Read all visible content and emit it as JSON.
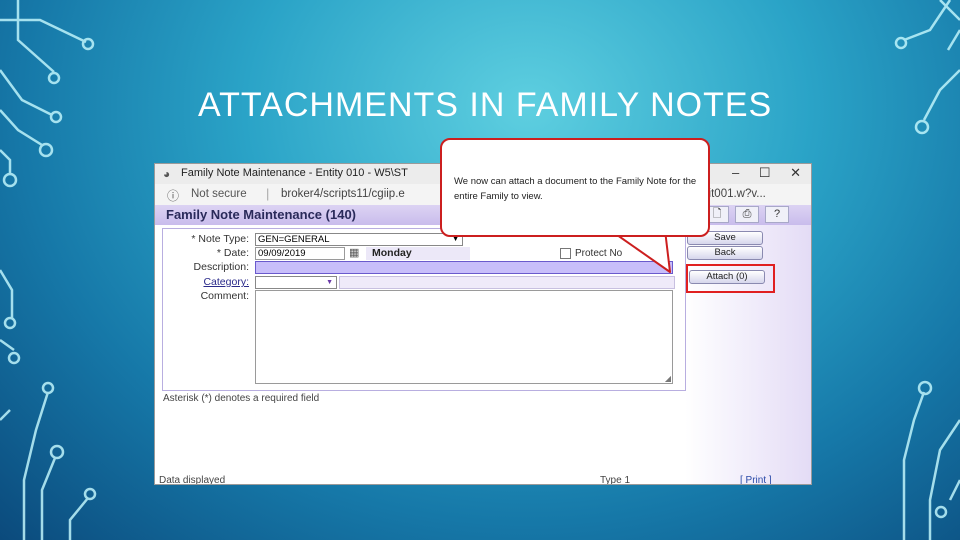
{
  "slide": {
    "title": "ATTACHMENTS IN FAMILY NOTES",
    "background_colors": [
      "#5ecfe0",
      "#2aa3c7",
      "#1678a8",
      "#0b4a7c"
    ]
  },
  "browser": {
    "window_title": "Family Note Maintenance - Entity 010 - W5\\ST",
    "window_controls": [
      "–",
      "☐",
      "✕"
    ],
    "security_label": "Not secure",
    "url": "broker4/scripts11/cgiip.e",
    "url_tail": "lit001.w?v..."
  },
  "app": {
    "header_title": "Family Note Maintenance (140)",
    "toolbar_icons": [
      "attach-doc-icon",
      "print-icon",
      "help-icon"
    ],
    "form": {
      "note_type_label": "* Note Type:",
      "note_type_value": "GEN=GENERAL",
      "date_label": "* Date:",
      "date_value": "09/09/2019",
      "day_value": "Monday",
      "protect_label": "Protect No",
      "description_label": "Description:",
      "description_value": "",
      "category_label": "Category:",
      "category_value": "",
      "comment_label": "Comment:",
      "comment_value": ""
    },
    "buttons": {
      "save": "Save",
      "back": "Back",
      "attach": "Attach (0)"
    },
    "required_note": "Asterisk (*) denotes a required field",
    "status_left": "Data displayed",
    "status_mid": "Type 1",
    "status_right": "[ Print ]"
  },
  "callout": {
    "text": "We now can attach a document to the Family Note for the entire Family to view."
  },
  "colors": {
    "callout_border": "#cc1f1f",
    "highlight_border": "#e02020",
    "header_purple": "#c9bcec"
  }
}
